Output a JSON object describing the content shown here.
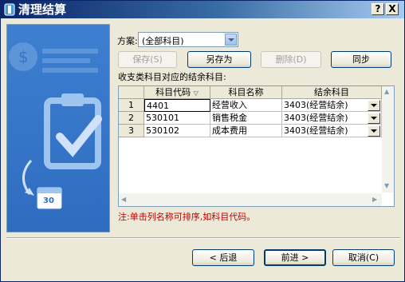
{
  "window": {
    "title": "清理结算",
    "help_label": "?",
    "close_label": "X"
  },
  "scheme": {
    "label": "方案:",
    "value": "(全部科目)"
  },
  "toolbar": {
    "save_label": "保存(S)",
    "save_as_label": "另存为",
    "delete_label": "删除(D)",
    "sync_label": "同步"
  },
  "section_label": "收支类科目对应的结余科目:",
  "grid": {
    "headers": {
      "code": "科目代码",
      "name": "科目名称",
      "balance": "结余科目"
    },
    "rows": [
      {
        "num": "1",
        "code": "4401",
        "name": "经营收入",
        "balance": "3403(经营结余)"
      },
      {
        "num": "2",
        "code": "530101",
        "name": "销售税金",
        "balance": "3403(经营结余)"
      },
      {
        "num": "3",
        "code": "530102",
        "name": "成本费用",
        "balance": "3403(经营结余)"
      }
    ]
  },
  "note": "注:单击列名称可排序,如科目代码。",
  "footer": {
    "back_label": "< 后退",
    "next_label": "前进 >",
    "cancel_label": "取消(C)"
  },
  "side_panel": {
    "calendar_day": "30"
  },
  "colors": {
    "title_bar": "#0a246a",
    "side_panel": "#3e7fd0",
    "note": "#c00000"
  }
}
